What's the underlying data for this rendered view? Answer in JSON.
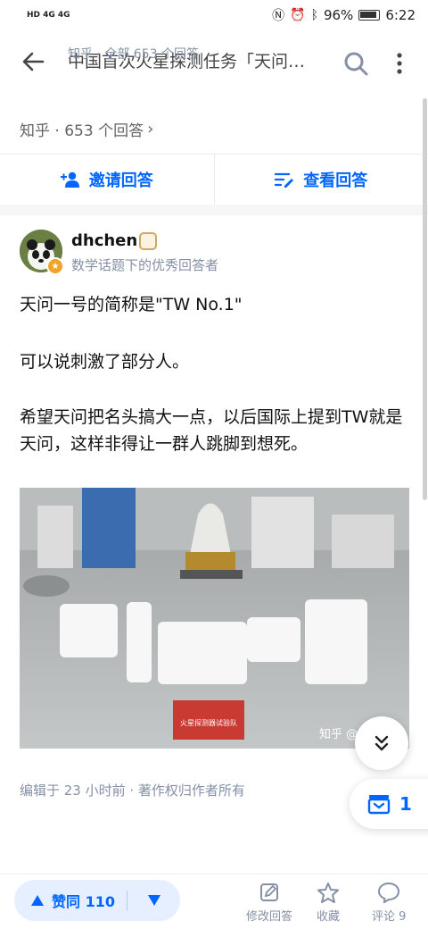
{
  "status": {
    "left": "HD 4G 4G",
    "battery": "96%",
    "time": "6:22"
  },
  "header": {
    "title": "中国首次火星探测任务「天问…",
    "subtitle": "知乎 · 全部 653 个回答"
  },
  "question": {
    "meta": "知乎 · 653 个回答"
  },
  "actions": {
    "invite": "邀请回答",
    "view": "查看回答"
  },
  "answer": {
    "author": "dhchen",
    "author_desc": "数学话题下的优秀回答者",
    "paragraphs": [
      "天问一号的简称是\"TW No.1\"",
      "可以说刺激了部分人。",
      "希望天问把名头搞大一点，以后国际上提到TW就是天问，这样非得让一群人跳脚到想死。"
    ],
    "image_watermark": "知乎 @",
    "banner_text": "火星探测器试验队",
    "edit_info": "编辑于 23 小时前 · 著作权归作者所有"
  },
  "fab": {
    "collection_count": "1"
  },
  "bottom": {
    "upvote": "赞同 110",
    "edit": "修改回答",
    "favorite": "收藏",
    "comment": "评论 9"
  },
  "colors": {
    "accent": "#0066ff",
    "muted": "#8590a6",
    "vote_bg": "#e5efff"
  }
}
